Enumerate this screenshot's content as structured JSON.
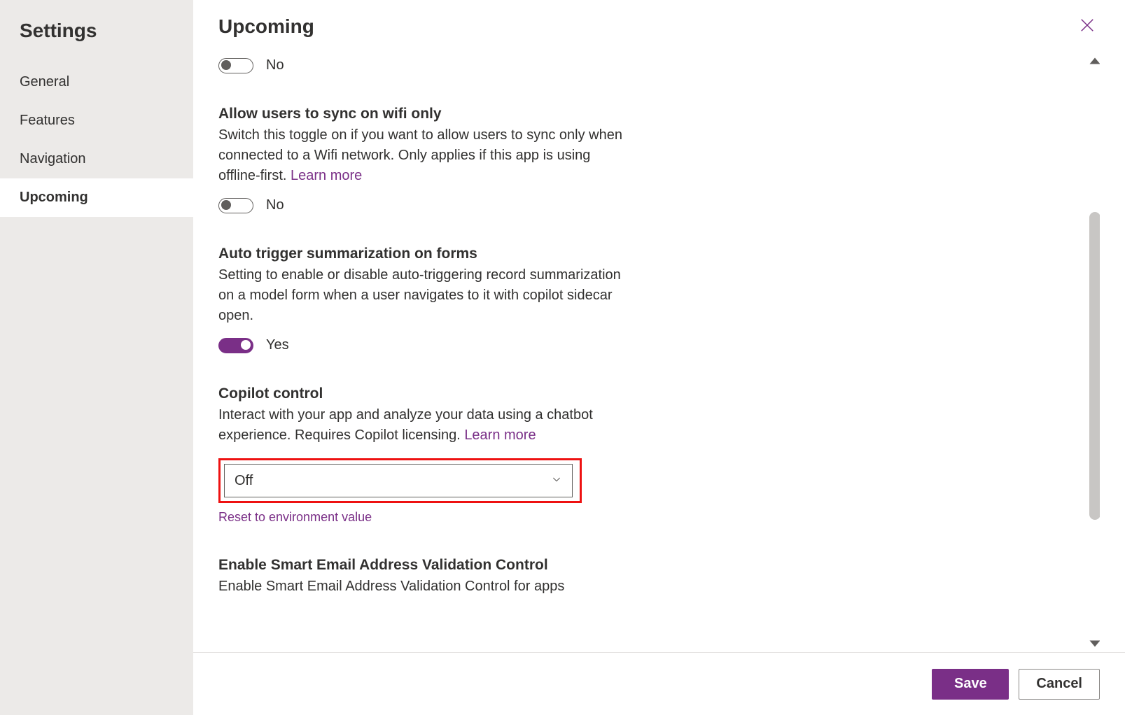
{
  "sidebar": {
    "title": "Settings",
    "items": [
      "General",
      "Features",
      "Navigation",
      "Upcoming"
    ],
    "active_index": 3
  },
  "header": {
    "title": "Upcoming"
  },
  "settings": {
    "orphan_toggle": {
      "value": "No"
    },
    "wifi": {
      "title": "Allow users to sync on wifi only",
      "desc": "Switch this toggle on if you want to allow users to sync only when connected to a Wifi network. Only applies if this app is using offline-first. ",
      "learn_more": "Learn more",
      "value": "No"
    },
    "summarize": {
      "title": "Auto trigger summarization on forms",
      "desc": "Setting to enable or disable auto-triggering record summarization on a model form when a user navigates to it with copilot sidecar open.",
      "value": "Yes"
    },
    "copilot": {
      "title": "Copilot control",
      "desc": "Interact with your app and analyze your data using a chatbot experience. Requires Copilot licensing. ",
      "learn_more": "Learn more",
      "selected": "Off",
      "reset": "Reset to environment value"
    },
    "email": {
      "title": "Enable Smart Email Address Validation Control",
      "desc": "Enable Smart Email Address Validation Control for apps"
    }
  },
  "footer": {
    "save": "Save",
    "cancel": "Cancel"
  }
}
